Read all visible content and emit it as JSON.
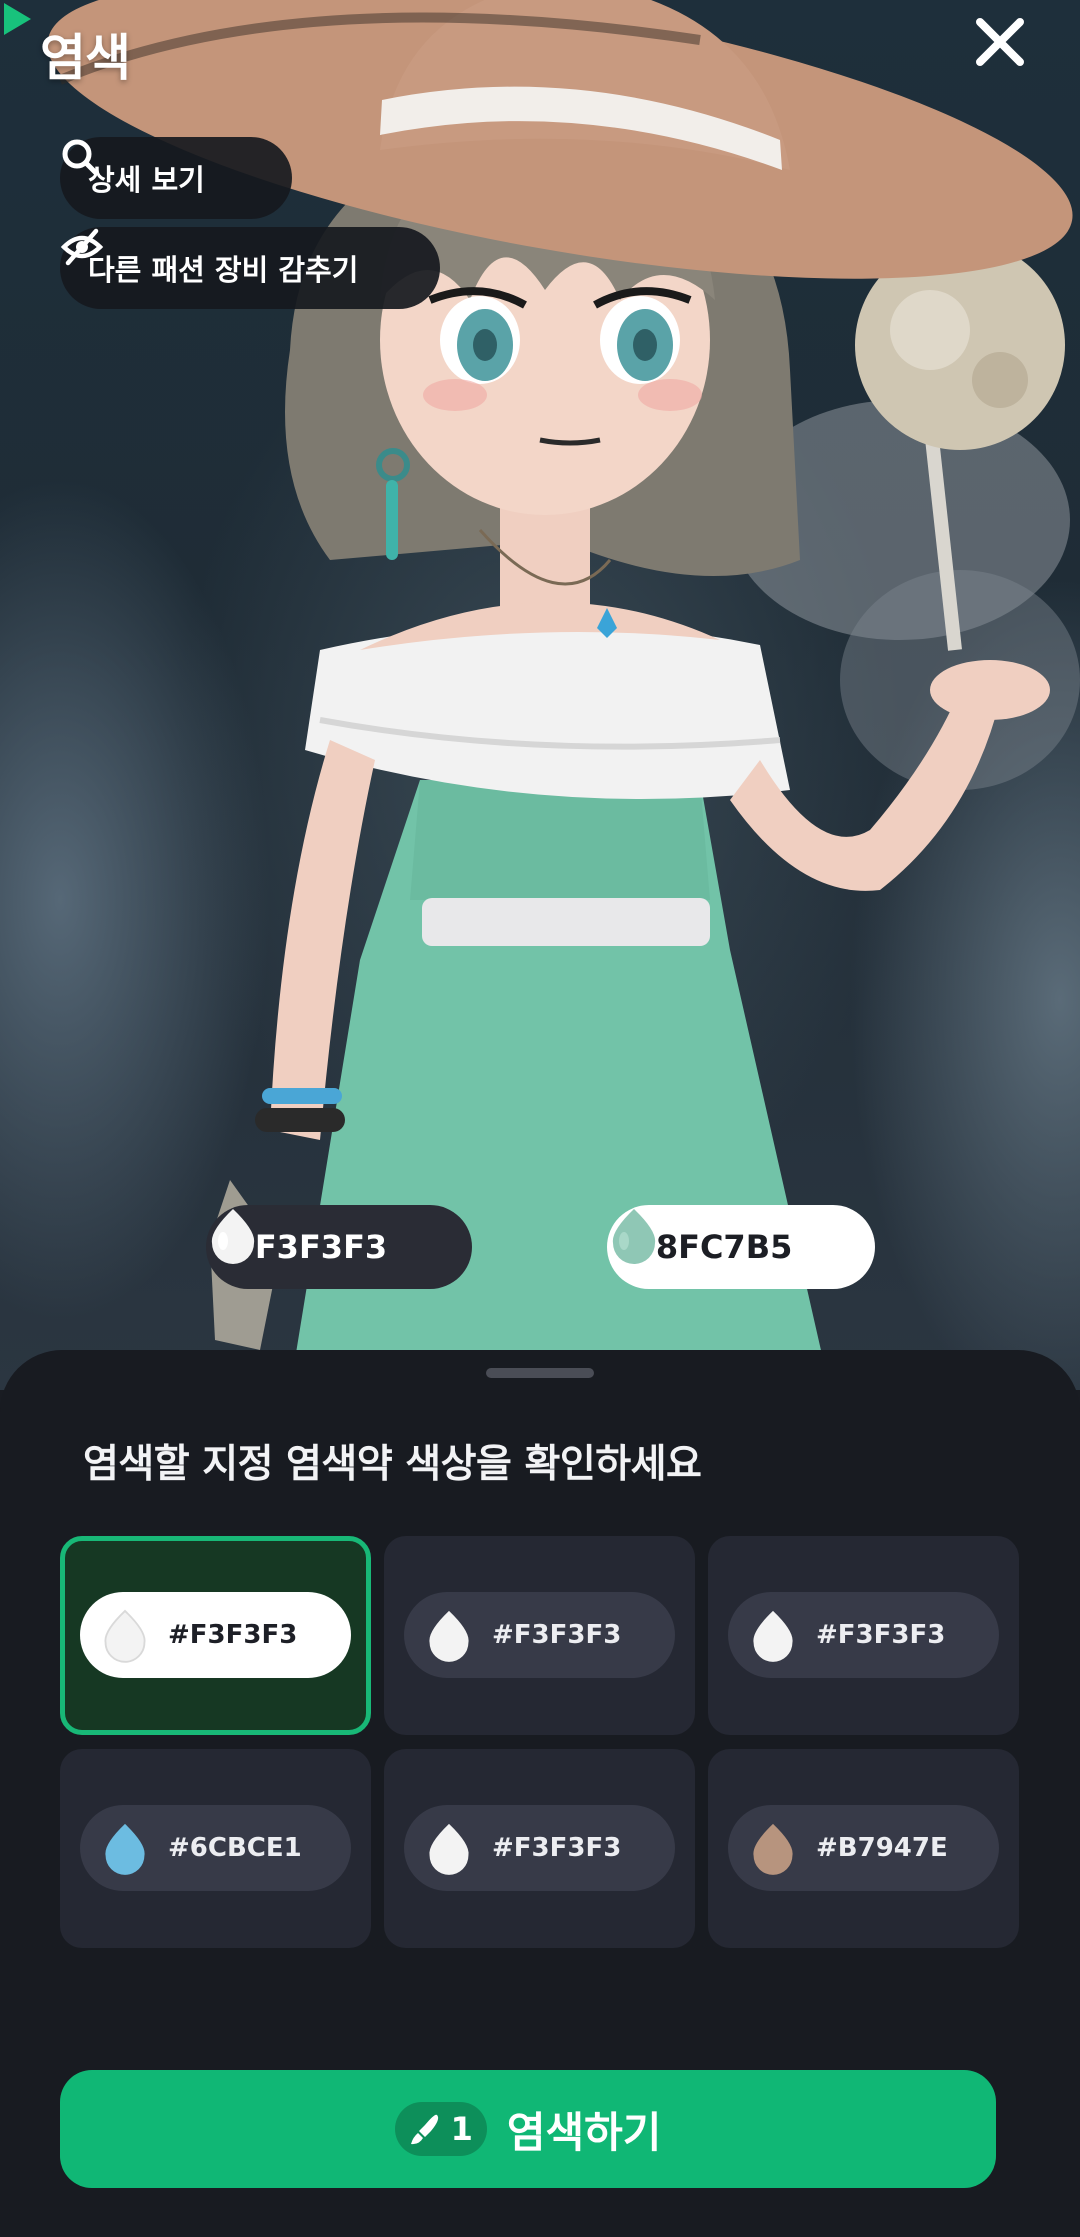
{
  "header": {
    "title": "염색",
    "close_icon": "close-icon"
  },
  "toolbar": {
    "detail_label": "상세 보기",
    "detail_icon": "search-icon",
    "hide_label": "다른 패션 장비 감추기",
    "hide_icon": "eye-off-icon"
  },
  "preview": {
    "from_color": "#F3F3F3",
    "to_color": "#8FC7B5",
    "arrow_icon": "play-arrow-icon",
    "arrow_color": "#18C27C"
  },
  "sheet": {
    "title": "염색할 지정 염색약 색상을 확인하세요",
    "swatches": [
      {
        "code": "#F3F3F3",
        "color": "#F3F3F3",
        "selected": true
      },
      {
        "code": "#F3F3F3",
        "color": "#F3F3F3",
        "selected": false
      },
      {
        "code": "#F3F3F3",
        "color": "#F3F3F3",
        "selected": false
      },
      {
        "code": "#6CBCE1",
        "color": "#6CBCE1",
        "selected": false
      },
      {
        "code": "#F3F3F3",
        "color": "#F3F3F3",
        "selected": false
      },
      {
        "code": "#B7947E",
        "color": "#B7947E",
        "selected": false
      }
    ]
  },
  "action": {
    "dye_count": "1",
    "dye_icon": "dye-brush-icon",
    "dye_label": "염색하기",
    "accent": "#10B775"
  }
}
